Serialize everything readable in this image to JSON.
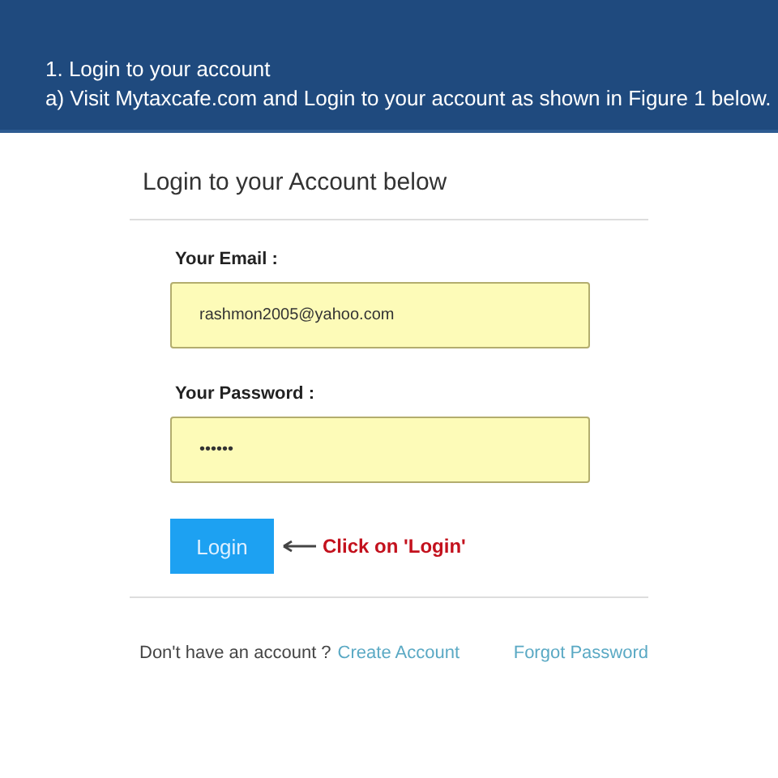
{
  "header": {
    "lines": [
      "1. Login to your account",
      "a) Visit Mytaxcafe.com and Login to your account as shown in Figure 1 below."
    ]
  },
  "form": {
    "title": "Login to your Account below",
    "fields": [
      {
        "label": "Your Email :",
        "value": "rashmon2005@yahoo.com"
      },
      {
        "label": "Your Password :",
        "value": "••••••"
      }
    ],
    "button": "Login",
    "annotation": "Click on 'Login'",
    "footer": {
      "prompt": "Don't have an account ?",
      "create_link": "Create Account",
      "forgot_link": "Forgot Password"
    }
  }
}
